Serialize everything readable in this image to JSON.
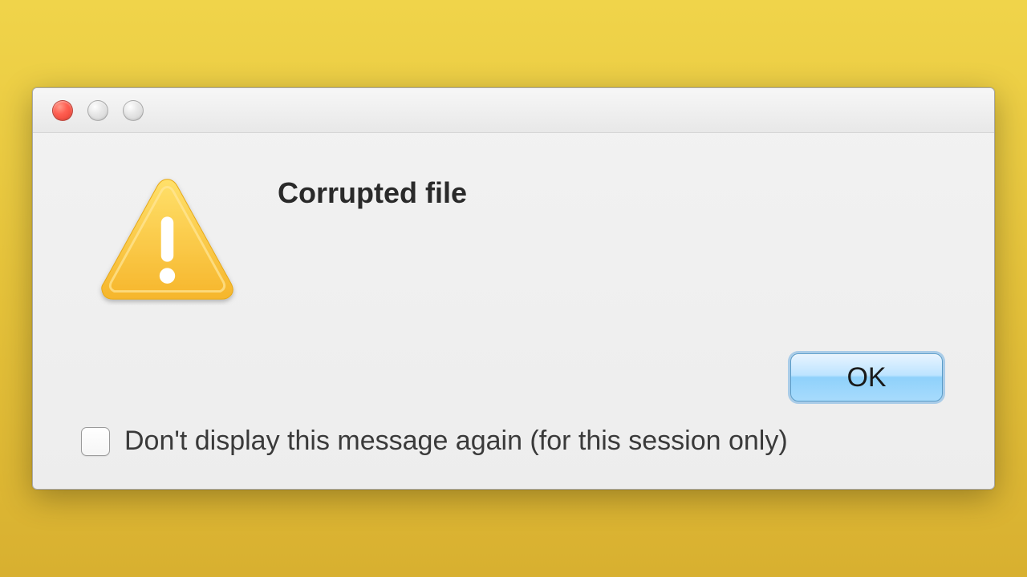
{
  "dialog": {
    "title": "Corrupted file",
    "ok_label": "OK",
    "suppress_label": "Don't display this message again (for this session only)",
    "suppress_checked": false
  },
  "icons": {
    "warning": "warning-triangle-icon",
    "close": "close-icon",
    "minimize": "minimize-icon",
    "zoom": "zoom-icon"
  },
  "colors": {
    "background": "#e5c23a",
    "dialog_bg": "#ededed",
    "button_accent": "#8fd1fb",
    "warning_fill": "#f9c642"
  }
}
